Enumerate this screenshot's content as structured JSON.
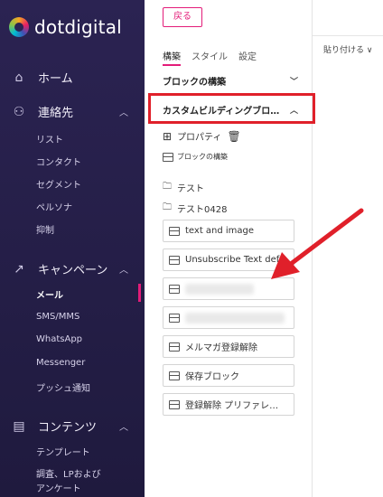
{
  "brand": {
    "name": "dotdigital"
  },
  "sidebar": {
    "home": "ホーム",
    "contacts": {
      "label": "連絡先",
      "items": [
        "リスト",
        "コンタクト",
        "セグメント",
        "ペルソナ",
        "抑制"
      ]
    },
    "campaigns": {
      "label": "キャンペーン",
      "items": [
        "メール",
        "SMS/MMS",
        "WhatsApp",
        "Messenger",
        "プッシュ通知"
      ],
      "active": "メール"
    },
    "content": {
      "label": "コンテンツ",
      "items": [
        "テンプレート",
        "調査、LPおよび",
        "アンケート"
      ]
    }
  },
  "panel": {
    "back": "戻る",
    "tabs": [
      "構築",
      "スタイル",
      "設定"
    ],
    "section_build": "ブロックの構築",
    "section_custom": "カスタムビルディングブロ…",
    "properties": "プロパティ",
    "small_label": "ブロックの構築",
    "folders": [
      "テスト",
      "テスト0428"
    ],
    "blocks": [
      "text and image",
      "Unsubscribe Text defa",
      "",
      "",
      "メルマガ登録解除",
      "保存ブロック",
      "登録解除 プリファレ…"
    ]
  },
  "right": {
    "paste": "貼り付ける ∨"
  },
  "colors": {
    "accent": "#e31c79",
    "highlight": "#e0202a",
    "sidebar_bg": "#2b2352"
  }
}
